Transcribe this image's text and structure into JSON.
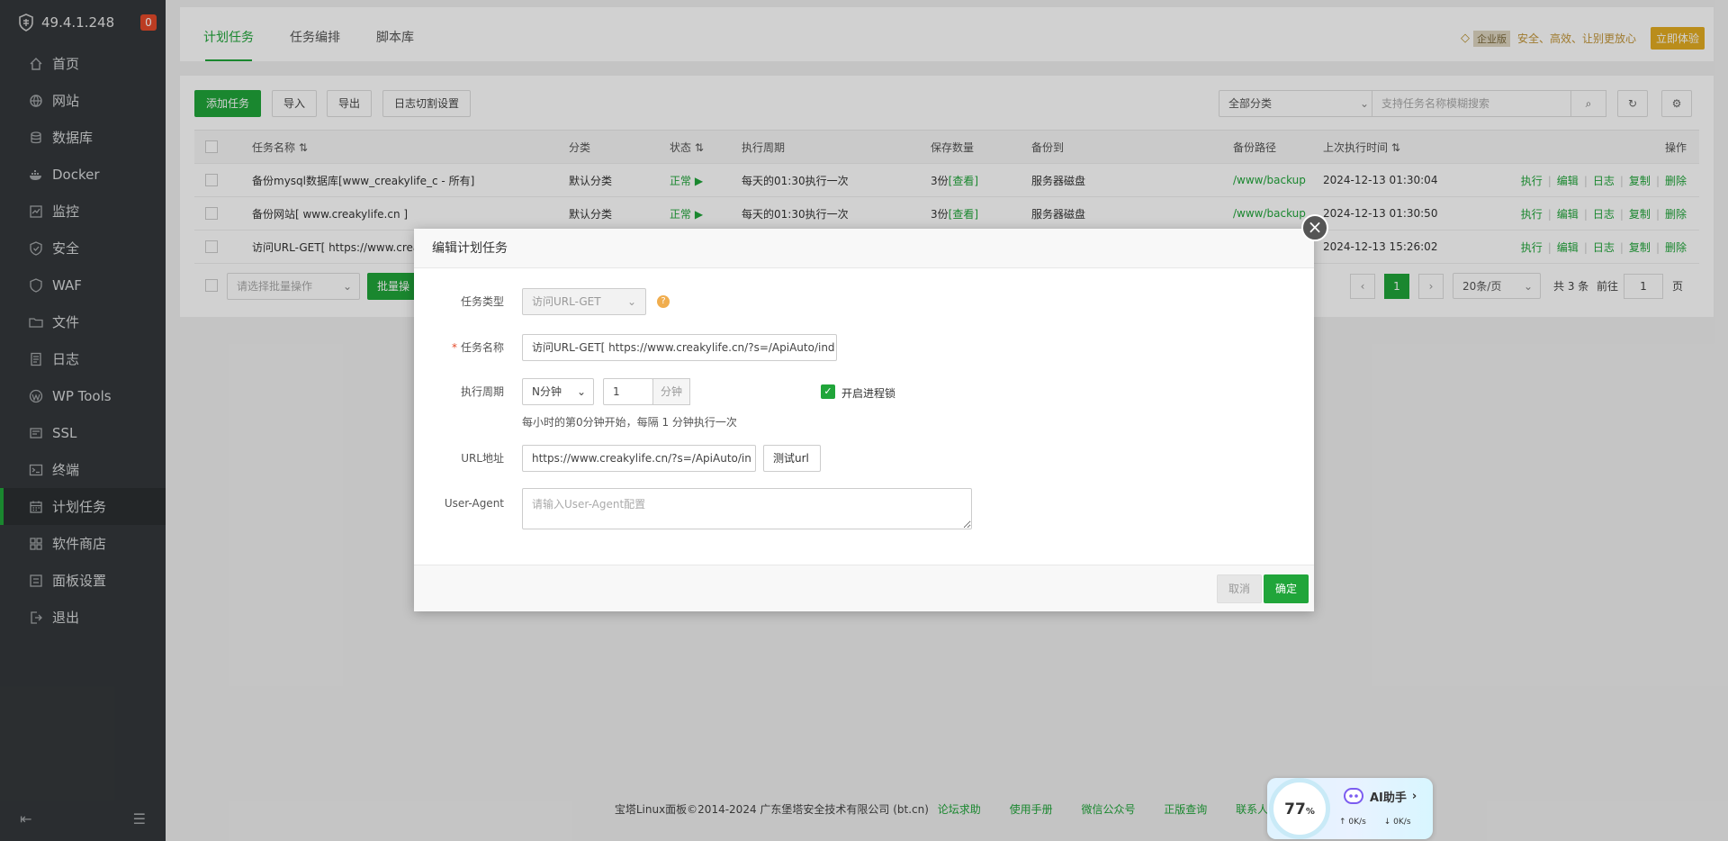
{
  "sidebar": {
    "ip": "49.4.1.248",
    "badge": "0",
    "items": [
      {
        "label": "首页",
        "icon": "home-icon"
      },
      {
        "label": "网站",
        "icon": "globe-icon"
      },
      {
        "label": "数据库",
        "icon": "database-icon"
      },
      {
        "label": "Docker",
        "icon": "docker-icon"
      },
      {
        "label": "监控",
        "icon": "monitor-icon"
      },
      {
        "label": "安全",
        "icon": "shield-icon"
      },
      {
        "label": "WAF",
        "icon": "waf-shield-icon"
      },
      {
        "label": "文件",
        "icon": "folder-icon"
      },
      {
        "label": "日志",
        "icon": "log-icon"
      },
      {
        "label": "WP Tools",
        "icon": "wordpress-icon"
      },
      {
        "label": "SSL",
        "icon": "ssl-icon"
      },
      {
        "label": "终端",
        "icon": "terminal-icon"
      },
      {
        "label": "计划任务",
        "icon": "calendar-icon",
        "active": true
      },
      {
        "label": "软件商店",
        "icon": "store-icon"
      },
      {
        "label": "面板设置",
        "icon": "settings-icon"
      },
      {
        "label": "退出",
        "icon": "logout-icon"
      }
    ]
  },
  "tabs": [
    "计划任务",
    "任务编排",
    "脚本库"
  ],
  "promo": {
    "enterprise": "企业版",
    "slogan": "安全、高效、让别更放心",
    "try": "立即体验"
  },
  "toolbar": {
    "add": "添加任务",
    "import": "导入",
    "export": "导出",
    "log_cut": "日志切割设置",
    "category": "全部分类",
    "search_placeholder": "支持任务名称模糊搜索"
  },
  "table": {
    "headers": [
      "任务名称",
      "分类",
      "状态",
      "执行周期",
      "保存数量",
      "备份到",
      "备份路径",
      "上次执行时间",
      "操作"
    ],
    "rows": [
      {
        "name": "备份mysql数据库[www_creakylife_c - 所有]",
        "category": "默认分类",
        "status": "正常",
        "cycle": "每天的01:30执行一次",
        "keep": "3份",
        "keep_link": "[查看]",
        "dest": "服务器磁盘",
        "path": "/www/backup",
        "last": "2024-12-13 01:30:04"
      },
      {
        "name": "备份网站[ www.creakylife.cn ]",
        "category": "默认分类",
        "status": "正常",
        "cycle": "每天的01:30执行一次",
        "keep": "3份",
        "keep_link": "[查看]",
        "dest": "服务器磁盘",
        "path": "/www/backup",
        "last": "2024-12-13 01:30:50"
      },
      {
        "name": "访问URL-GET[ https://www.crea",
        "category": "",
        "status": "",
        "cycle": "",
        "keep": "",
        "keep_link": "",
        "dest": "",
        "path": "",
        "last": "2024-12-13 15:26:02"
      }
    ],
    "ops": [
      "执行",
      "编辑",
      "日志",
      "复制",
      "删除"
    ]
  },
  "batch": {
    "placeholder": "请选择批量操作",
    "button": "批量操"
  },
  "pagination": {
    "current": "1",
    "per_page": "20条/页",
    "total": "共 3 条",
    "goto": "前往",
    "page_input": "1",
    "page_unit": "页"
  },
  "footer": {
    "copyright": "宝塔Linux面板©2014-2024 广东堡塔安全技术有限公司 (bt.cn)",
    "links": [
      "论坛求助",
      "使用手册",
      "微信公众号",
      "正版查询",
      "联系人工"
    ]
  },
  "dialog": {
    "title": "编辑计划任务",
    "type_label": "任务类型",
    "type_value": "访问URL-GET",
    "name_label": "任务名称",
    "name_value": "访问URL-GET[ https://www.creakylife.cn/?s=/ApiAuto/ind",
    "cycle_label": "执行周期",
    "cycle_value": "N分钟",
    "cycle_num": "1",
    "cycle_unit": "分钟",
    "lock_label": "开启进程锁",
    "cycle_hint": "每小时的第0分钟开始，每隔 1 分钟执行一次",
    "url_label": "URL地址",
    "url_value": "https://www.creakylife.cn/?s=/ApiAuto/in",
    "test_url": "测试url",
    "ua_label": "User-Agent",
    "ua_placeholder": "请输入User-Agent配置",
    "cancel": "取消",
    "confirm": "确定"
  },
  "widget": {
    "percent": "77",
    "percent_unit": "%",
    "ai": "AI助手",
    "up": "0K/s",
    "down": "0K/s"
  }
}
